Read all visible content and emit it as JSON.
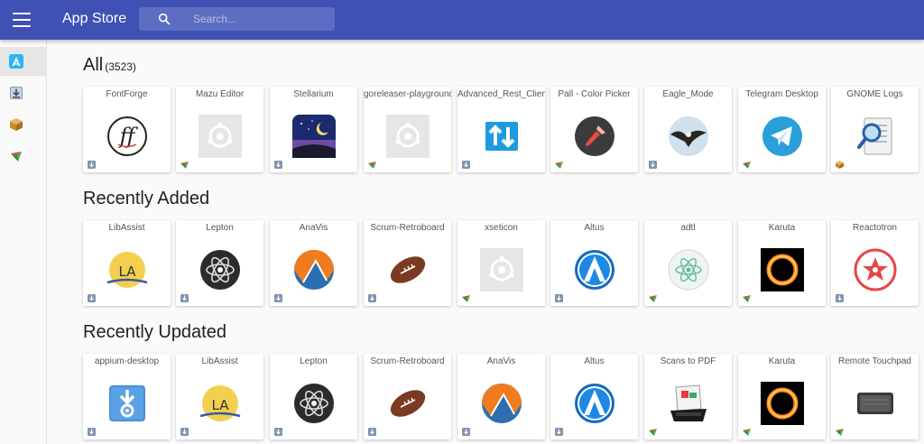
{
  "app": {
    "title": "App Store"
  },
  "search": {
    "placeholder": "Search..."
  },
  "sidebar": {
    "items": [
      {
        "name": "sidebar-item-appcenter",
        "icon": "appcenter-icon"
      },
      {
        "name": "sidebar-item-appimage",
        "icon": "download-box-icon"
      },
      {
        "name": "sidebar-item-snap",
        "icon": "package-icon"
      },
      {
        "name": "sidebar-item-flatpak",
        "icon": "flatpak-icon"
      }
    ]
  },
  "sections": [
    {
      "title": "All",
      "count": "(3523)",
      "apps": [
        {
          "name": "FontForge",
          "icon": "fontforge-icon",
          "source": "appimage"
        },
        {
          "name": "Mazu Editor",
          "icon": "placeholder-icon",
          "source": "flatpak"
        },
        {
          "name": "Stellarium",
          "icon": "stellarium-icon",
          "source": "appimage"
        },
        {
          "name": "goreleaser-playground",
          "icon": "placeholder-icon",
          "source": "flatpak"
        },
        {
          "name": "Advanced_Rest_Client",
          "icon": "arrows-icon",
          "source": "appimage"
        },
        {
          "name": "Pall - Color Picker",
          "icon": "color-picker-icon",
          "source": "flatpak"
        },
        {
          "name": "Eagle_Mode",
          "icon": "eagle-icon",
          "source": "appimage"
        },
        {
          "name": "Telegram Desktop",
          "icon": "telegram-icon",
          "source": "flatpak"
        },
        {
          "name": "GNOME Logs",
          "icon": "logs-icon",
          "source": "snap"
        }
      ]
    },
    {
      "title": "Recently Added",
      "count": "",
      "apps": [
        {
          "name": "LibAssist",
          "icon": "libassist-icon",
          "source": "appimage"
        },
        {
          "name": "Lepton",
          "icon": "atom-icon",
          "source": "appimage"
        },
        {
          "name": "AnaVis",
          "icon": "anavis-icon",
          "source": "appimage"
        },
        {
          "name": "Scrum-Retroboard",
          "icon": "football-icon",
          "source": "appimage"
        },
        {
          "name": "xseticon",
          "icon": "placeholder-icon",
          "source": "flatpak"
        },
        {
          "name": "Altus",
          "icon": "altus-icon",
          "source": "appimage"
        },
        {
          "name": "adtl",
          "icon": "electron-icon",
          "source": "flatpak"
        },
        {
          "name": "Karuta",
          "icon": "karuta-icon",
          "source": "flatpak"
        },
        {
          "name": "Reactotron",
          "icon": "reactotron-icon",
          "source": "appimage"
        }
      ]
    },
    {
      "title": "Recently Updated",
      "count": "",
      "apps": [
        {
          "name": "appium-desktop",
          "icon": "appium-icon",
          "source": "appimage"
        },
        {
          "name": "LibAssist",
          "icon": "libassist-icon",
          "source": "appimage"
        },
        {
          "name": "Lepton",
          "icon": "atom-icon",
          "source": "appimage"
        },
        {
          "name": "Scrum-Retroboard",
          "icon": "football-icon",
          "source": "appimage"
        },
        {
          "name": "AnaVis",
          "icon": "anavis-icon",
          "source": "appimage"
        },
        {
          "name": "Altus",
          "icon": "altus-icon",
          "source": "appimage"
        },
        {
          "name": "Scans to PDF",
          "icon": "scanner-icon",
          "source": "flatpak"
        },
        {
          "name": "Karuta",
          "icon": "karuta-icon",
          "source": "flatpak"
        },
        {
          "name": "Remote Touchpad",
          "icon": "touchpad-icon",
          "source": "flatpak"
        }
      ]
    }
  ],
  "colors": {
    "appbar": "#3f51b5",
    "background": "#fafafa",
    "card": "#ffffff"
  }
}
